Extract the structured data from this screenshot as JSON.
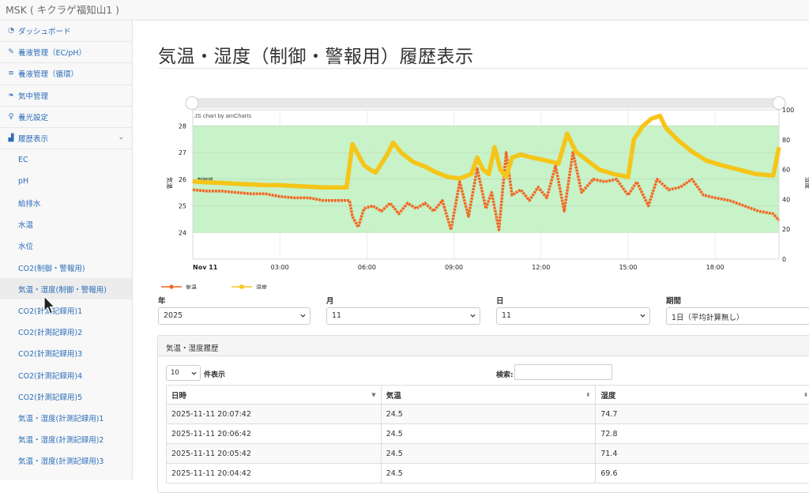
{
  "app": {
    "title": "MSK ( キクラゲ福知山1 )"
  },
  "sidebar": {
    "items": [
      {
        "label": "ダッシュボード",
        "icon": "gauge-icon"
      },
      {
        "label": "養液管理（EC/pH）",
        "icon": "wrench-icon"
      },
      {
        "label": "養液管理（循環）",
        "icon": "bars-icon"
      },
      {
        "label": "気中管理",
        "icon": "leaf-icon"
      },
      {
        "label": "養光設定",
        "icon": "bulb-icon"
      },
      {
        "label": "履歴表示",
        "icon": "chart-icon"
      }
    ],
    "sub_items": [
      "EC",
      "pH",
      "給排水",
      "水温",
      "水位",
      "CO2(制御・警報用)",
      "気温・湿度(制御・警報用)",
      "CO2(計測記録用)1",
      "CO2(計測記録用)2",
      "CO2(計測記録用)3",
      "CO2(計測記録用)4",
      "CO2(計測記録用)5",
      "気温・湿度(計測記録用)1",
      "気温・湿度(計測記録用)2",
      "気温・湿度(計測記録用)3"
    ],
    "active_sub": "気温・湿度(制御・警報用)"
  },
  "page": {
    "title": "気温・湿度（制御・警報用）履歴表示"
  },
  "chart_data": {
    "type": "line",
    "credit": "JS chart by amCharts",
    "band_label": "制御域",
    "y_left": {
      "label": "気温",
      "ticks": [
        24,
        25,
        26,
        27,
        28
      ],
      "range": [
        23.0,
        28.6
      ]
    },
    "y_right": {
      "label": "湿度",
      "ticks": [
        0,
        20,
        40,
        60,
        80,
        100
      ],
      "range": [
        0,
        100
      ]
    },
    "x_ticks": [
      "Nov 11",
      "03:00",
      "06:00",
      "09:00",
      "12:00",
      "15:00",
      "18:00"
    ],
    "x_range_hours": [
      0,
      20.2
    ],
    "band": {
      "axis": "left",
      "from": 24.0,
      "to": 28.0
    },
    "series": [
      {
        "name": "気温",
        "axis": "left",
        "color": "#f26722",
        "points": [
          [
            0,
            25.6
          ],
          [
            0.5,
            25.55
          ],
          [
            1,
            25.55
          ],
          [
            1.5,
            25.5
          ],
          [
            2,
            25.45
          ],
          [
            2.5,
            25.45
          ],
          [
            3,
            25.35
          ],
          [
            3.5,
            25.3
          ],
          [
            4,
            25.3
          ],
          [
            4.5,
            25.2
          ],
          [
            5,
            25.2
          ],
          [
            5.4,
            25.2
          ],
          [
            5.5,
            24.6
          ],
          [
            5.7,
            24.2
          ],
          [
            5.9,
            24.9
          ],
          [
            6.2,
            25.0
          ],
          [
            6.5,
            24.8
          ],
          [
            6.8,
            25.1
          ],
          [
            7.1,
            24.7
          ],
          [
            7.4,
            25.1
          ],
          [
            7.7,
            24.9
          ],
          [
            8.0,
            25.1
          ],
          [
            8.3,
            24.8
          ],
          [
            8.6,
            25.2
          ],
          [
            8.9,
            24.1
          ],
          [
            9.2,
            25.9
          ],
          [
            9.5,
            24.6
          ],
          [
            9.8,
            26.4
          ],
          [
            10.1,
            24.9
          ],
          [
            10.3,
            25.5
          ],
          [
            10.55,
            24.1
          ],
          [
            10.8,
            27.0
          ],
          [
            11.0,
            25.4
          ],
          [
            11.3,
            25.6
          ],
          [
            11.6,
            25.2
          ],
          [
            11.9,
            25.7
          ],
          [
            12.2,
            25.3
          ],
          [
            12.5,
            26.5
          ],
          [
            12.8,
            24.8
          ],
          [
            13.1,
            27.0
          ],
          [
            13.4,
            25.5
          ],
          [
            13.8,
            26.0
          ],
          [
            14.2,
            25.9
          ],
          [
            14.6,
            26.0
          ],
          [
            15.0,
            25.4
          ],
          [
            15.3,
            25.9
          ],
          [
            15.7,
            25.0
          ],
          [
            16.0,
            26.0
          ],
          [
            16.4,
            25.6
          ],
          [
            16.8,
            25.7
          ],
          [
            17.2,
            26.0
          ],
          [
            17.6,
            25.4
          ],
          [
            18.0,
            25.3
          ],
          [
            18.5,
            25.2
          ],
          [
            19.0,
            25.0
          ],
          [
            19.5,
            24.8
          ],
          [
            20.0,
            24.7
          ],
          [
            20.2,
            24.45
          ]
        ]
      },
      {
        "name": "湿度",
        "axis": "right",
        "color": "#f5c518",
        "points": [
          [
            0,
            52
          ],
          [
            0.5,
            51.5
          ],
          [
            1,
            51
          ],
          [
            1.5,
            50.5
          ],
          [
            2,
            50
          ],
          [
            2.5,
            49.5
          ],
          [
            3,
            49.5
          ],
          [
            3.5,
            49
          ],
          [
            4,
            48.5
          ],
          [
            4.5,
            48
          ],
          [
            5,
            48
          ],
          [
            5.3,
            48
          ],
          [
            5.5,
            77
          ],
          [
            5.7,
            70
          ],
          [
            5.9,
            63
          ],
          [
            6.1,
            60
          ],
          [
            6.3,
            58
          ],
          [
            6.7,
            70
          ],
          [
            6.9,
            78
          ],
          [
            7.2,
            71
          ],
          [
            7.6,
            65
          ],
          [
            8.0,
            62
          ],
          [
            8.4,
            58
          ],
          [
            8.8,
            55
          ],
          [
            9.2,
            54
          ],
          [
            9.6,
            57
          ],
          [
            9.8,
            68
          ],
          [
            10.0,
            60
          ],
          [
            10.2,
            57
          ],
          [
            10.4,
            75
          ],
          [
            10.6,
            60
          ],
          [
            10.8,
            55
          ],
          [
            11.0,
            68
          ],
          [
            11.3,
            70
          ],
          [
            11.7,
            68
          ],
          [
            12.2,
            66
          ],
          [
            12.6,
            64
          ],
          [
            12.9,
            84
          ],
          [
            13.2,
            72
          ],
          [
            13.6,
            66
          ],
          [
            14.0,
            60
          ],
          [
            14.5,
            57
          ],
          [
            15.0,
            55
          ],
          [
            15.2,
            80
          ],
          [
            15.5,
            89
          ],
          [
            15.8,
            94
          ],
          [
            16.1,
            96
          ],
          [
            16.3,
            88
          ],
          [
            16.7,
            80
          ],
          [
            17.2,
            72
          ],
          [
            17.7,
            66
          ],
          [
            18.2,
            63
          ],
          [
            18.8,
            60
          ],
          [
            19.4,
            57
          ],
          [
            20.0,
            56
          ],
          [
            20.1,
            65
          ],
          [
            20.2,
            75
          ]
        ]
      }
    ]
  },
  "filters": {
    "year": {
      "label": "年",
      "value": "2025"
    },
    "month": {
      "label": "月",
      "value": "11"
    },
    "day": {
      "label": "日",
      "value": "11"
    },
    "period": {
      "label": "期間",
      "value": "1日（平均計算無し）"
    }
  },
  "table": {
    "title": "気温・湿度履歴",
    "length_value": "10",
    "length_label": "件表示",
    "search_label": "検索:",
    "columns": [
      "日時",
      "気温",
      "湿度"
    ],
    "rows": [
      [
        "2025-11-11 20:07:42",
        "24.5",
        "74.7"
      ],
      [
        "2025-11-11 20:06:42",
        "24.5",
        "72.8"
      ],
      [
        "2025-11-11 20:05:42",
        "24.5",
        "71.4"
      ],
      [
        "2025-11-11 20:04:42",
        "24.5",
        "69.6"
      ]
    ]
  }
}
